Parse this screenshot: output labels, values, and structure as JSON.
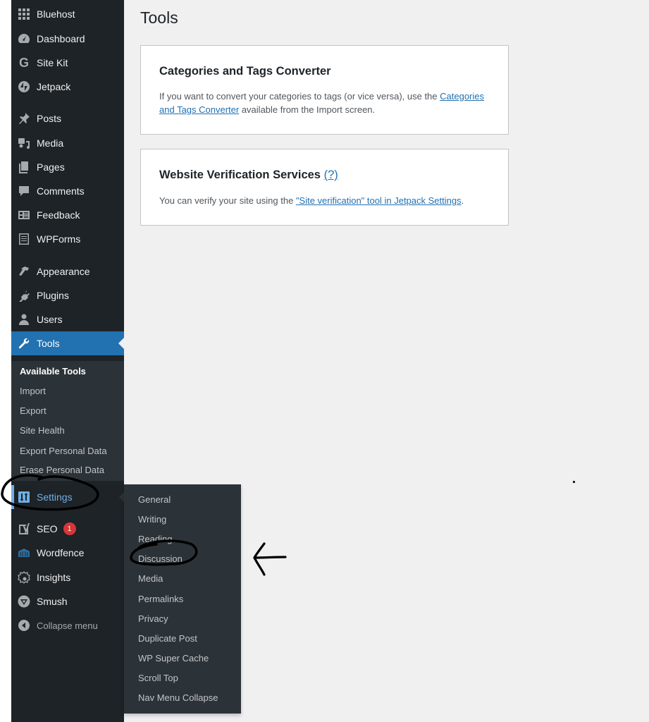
{
  "page": {
    "title": "Tools"
  },
  "sidebar": {
    "items": [
      {
        "label": "Bluehost",
        "icon": "grid-icon"
      },
      {
        "label": "Dashboard",
        "icon": "dashboard-gauge-icon"
      },
      {
        "label": "Site Kit",
        "icon": "google-g-icon"
      },
      {
        "label": "Jetpack",
        "icon": "jetpack-bolt-icon"
      },
      {
        "label": "Posts",
        "icon": "pushpin-icon"
      },
      {
        "label": "Media",
        "icon": "media-icon"
      },
      {
        "label": "Pages",
        "icon": "pages-icon"
      },
      {
        "label": "Comments",
        "icon": "comment-bubble-icon"
      },
      {
        "label": "Feedback",
        "icon": "feedback-list-icon"
      },
      {
        "label": "WPForms",
        "icon": "wpforms-icon"
      },
      {
        "label": "Appearance",
        "icon": "paintbrush-icon"
      },
      {
        "label": "Plugins",
        "icon": "plugin-plug-icon"
      },
      {
        "label": "Users",
        "icon": "user-icon"
      },
      {
        "label": "Tools",
        "icon": "wrench-icon"
      },
      {
        "label": "Settings",
        "icon": "settings-sliders-icon"
      },
      {
        "label": "SEO",
        "icon": "yoast-icon",
        "badge": "1"
      },
      {
        "label": "Wordfence",
        "icon": "wordfence-icon"
      },
      {
        "label": "Insights",
        "icon": "insights-icon"
      },
      {
        "label": "Smush",
        "icon": "smush-icon"
      },
      {
        "label": "Collapse menu",
        "icon": "collapse-arrow-icon"
      }
    ],
    "tools_submenu": [
      "Available Tools",
      "Import",
      "Export",
      "Site Health",
      "Export Personal Data",
      "Erase Personal Data"
    ]
  },
  "settings_flyout": {
    "items": [
      "General",
      "Writing",
      "Reading",
      "Discussion",
      "Media",
      "Permalinks",
      "Privacy",
      "Duplicate Post",
      "WP Super Cache",
      "Scroll Top",
      "Nav Menu Collapse"
    ]
  },
  "cards": {
    "converter": {
      "title": "Categories and Tags Converter",
      "text_before": "If you want to convert your categories to tags (or vice versa), use the ",
      "link": "Categories and Tags Converter",
      "text_after": " available from the Import screen."
    },
    "verification": {
      "title": "Website Verification Services",
      "help_link": "(?)",
      "text_before": "You can verify your site using the ",
      "link": "\"Site verification\" tool in Jetpack Settings",
      "text_after": "."
    }
  },
  "colors": {
    "accent": "#2271b1",
    "sidebar_bg": "#1d2327",
    "submenu_bg": "#2c3338",
    "badge": "#d63638",
    "settings_highlight": "#72aee6"
  }
}
